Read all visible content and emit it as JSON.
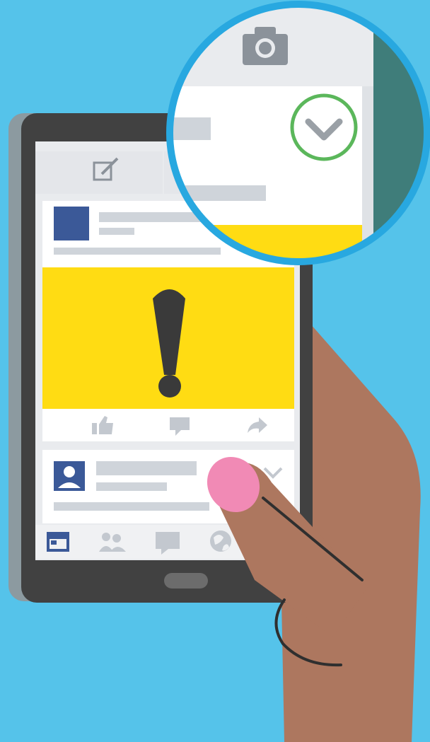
{
  "scene": {
    "description_labels": [],
    "colors": {
      "background": "#55c3ea",
      "phone_body": "#414141",
      "phone_side": "#8c9aa0",
      "screen_bg": "#e9ebee",
      "card_bg": "#ffffff",
      "placeholder_bar": "#cfd4da",
      "brand_blue": "#3b5998",
      "alert_yellow": "#ffdc13",
      "alert_mark": "#3a3a3a",
      "icon_gray": "#c3c8cf",
      "skin": "#ad775f",
      "nail": "#f18ab5",
      "magnifier_ring": "#28a8e0",
      "check_ring": "#5bb75b",
      "teal_panel": "#3f7d7a"
    },
    "icons": {
      "compose": "compose-icon",
      "camera": "camera-icon",
      "like": "like-icon",
      "comment": "comment-icon",
      "share": "share-icon",
      "profile": "profile-icon",
      "chevron": "chevron-down-icon",
      "news_feed": "news-feed-icon",
      "friends": "friends-icon",
      "messages": "messages-icon",
      "globe": "globe-icon"
    }
  }
}
